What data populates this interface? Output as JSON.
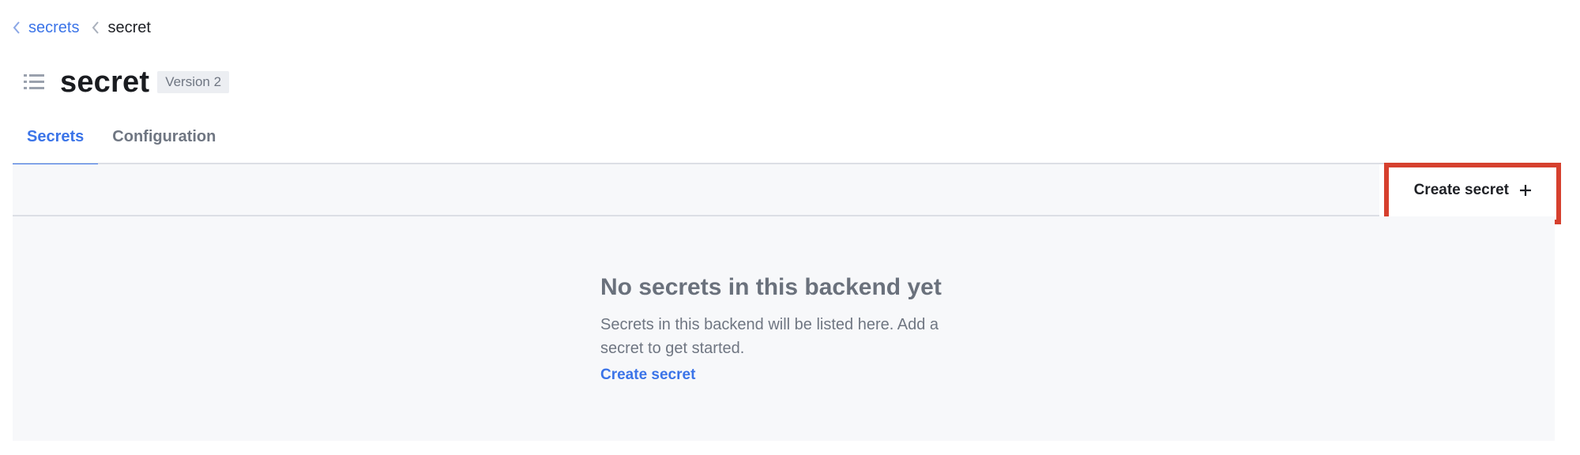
{
  "breadcrumb": {
    "items": [
      {
        "label": "secrets"
      },
      {
        "label": "secret"
      }
    ]
  },
  "header": {
    "title": "secret",
    "version_badge": "Version 2",
    "icon": "list-icon"
  },
  "tabs": [
    {
      "label": "Secrets",
      "active": true
    },
    {
      "label": "Configuration",
      "active": false
    }
  ],
  "toolbar": {
    "create_label": "Create secret",
    "create_icon": "plus-icon"
  },
  "empty_state": {
    "title": "No secrets in this backend yet",
    "body": "Secrets in this backend will be listed here. Add a secret to get started.",
    "link_label": "Create secret"
  },
  "colors": {
    "accent": "#3b74e8",
    "highlight": "#d6402e",
    "panel_bg": "#f7f8fa"
  }
}
